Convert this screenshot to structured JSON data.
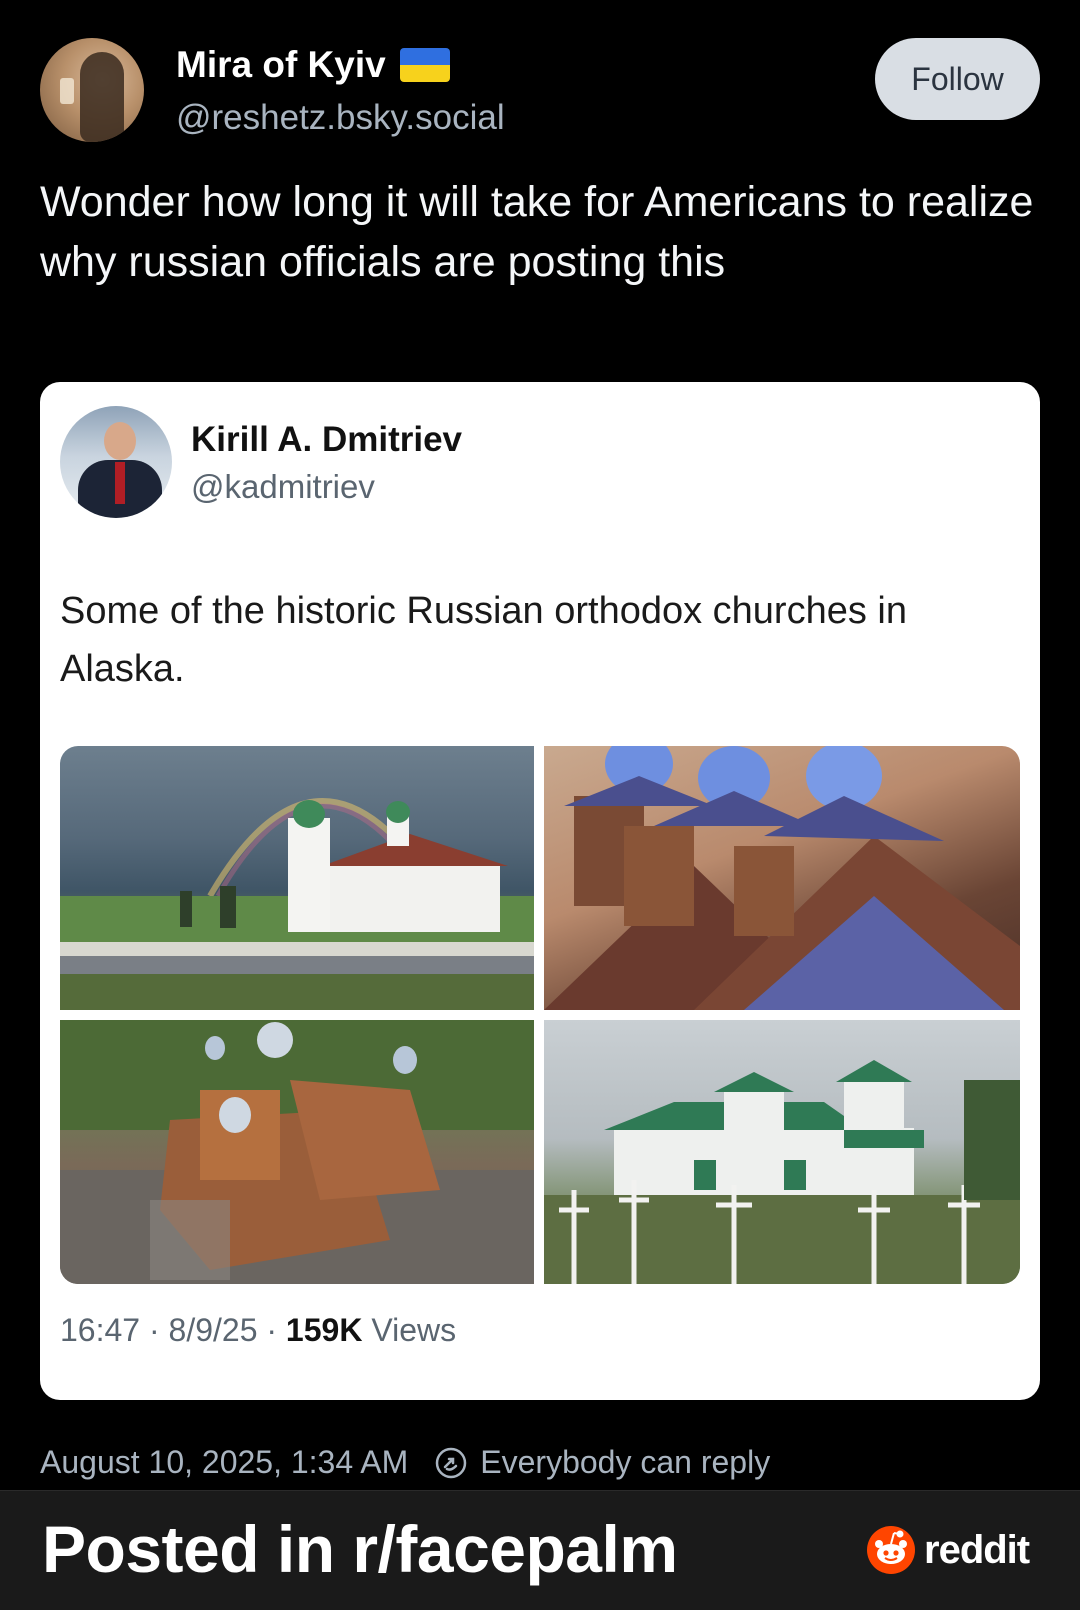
{
  "author": {
    "name": "Mira of Kyiv",
    "handle": "@reshetz.bsky.social",
    "flag": "ukraine-flag"
  },
  "follow_label": "Follow",
  "post_text": "Wonder how long it will take for Americans to realize why russian officials are posting this",
  "embed": {
    "name": "Kirill A. Dmitriev",
    "handle": "@kadmitriev",
    "text": "Some of the historic Russian orthodox churches in Alaska.",
    "time": "16:47",
    "date": "8/9/25",
    "views_count": "159K",
    "views_label": "Views",
    "separator": "·"
  },
  "footer": {
    "timestamp": "August 10, 2025, 1:34 AM",
    "reply_setting": "Everybody can reply"
  },
  "banner": {
    "text": "Posted in r/facepalm",
    "brand": "reddit"
  },
  "colors": {
    "background": "#000000",
    "follow_bg": "#d9dee4",
    "reddit_orange": "#ff4500",
    "muted_text": "#a9b4c0"
  }
}
